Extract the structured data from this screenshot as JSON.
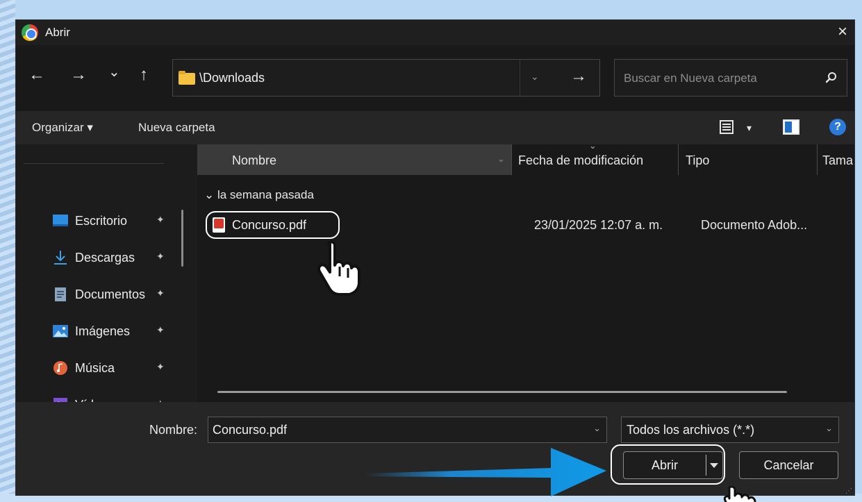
{
  "window": {
    "title": "Abrir",
    "close_icon": "×"
  },
  "nav": {
    "back_icon": "←",
    "forward_icon": "→",
    "recent_icon": "⌄",
    "up_icon": "↑",
    "address": "\\Downloads",
    "address_dropdown_icon": "⌄",
    "go_icon": "→",
    "search_placeholder": "Buscar en Nueva carpeta"
  },
  "toolbar": {
    "organize": "Organizar ▾",
    "new_folder": "Nueva carpeta",
    "view_dropdown_icon": "▾",
    "help": "?"
  },
  "sidebar": {
    "items": [
      {
        "label": "Escritorio",
        "icon": "desktop-icon",
        "color": "#2d8de0"
      },
      {
        "label": "Descargas",
        "icon": "download-icon",
        "color": "#3fa0e6"
      },
      {
        "label": "Documentos",
        "icon": "document-icon",
        "color": "#8aa4c2"
      },
      {
        "label": "Imágenes",
        "icon": "image-icon",
        "color": "#2f82d4"
      },
      {
        "label": "Música",
        "icon": "music-icon",
        "color": "#e2643a"
      },
      {
        "label": "Vídeos",
        "icon": "video-icon",
        "color": "#7b4fd3"
      }
    ],
    "pin_icon": "✦"
  },
  "columns": {
    "name": "Nombre",
    "modified": "Fecha de modificación",
    "type": "Tipo",
    "size": "Tama"
  },
  "group": {
    "label": "⌄ la semana pasada"
  },
  "files": [
    {
      "name": "Concurso.pdf",
      "modified": "23/01/2025 12:07 a. m.",
      "type": "Documento Adob..."
    }
  ],
  "bottom": {
    "filename_label": "Nombre:",
    "filename_value": "Concurso.pdf",
    "filter_value": "Todos los archivos (*.*)",
    "open_label": "Abrir",
    "cancel_label": "Cancelar",
    "chevron": "⌄"
  },
  "colors": {
    "arrow_blue": "#1a8fe0",
    "dialog_bg": "#1c1c1c",
    "pdf_red": "#d9362b"
  }
}
